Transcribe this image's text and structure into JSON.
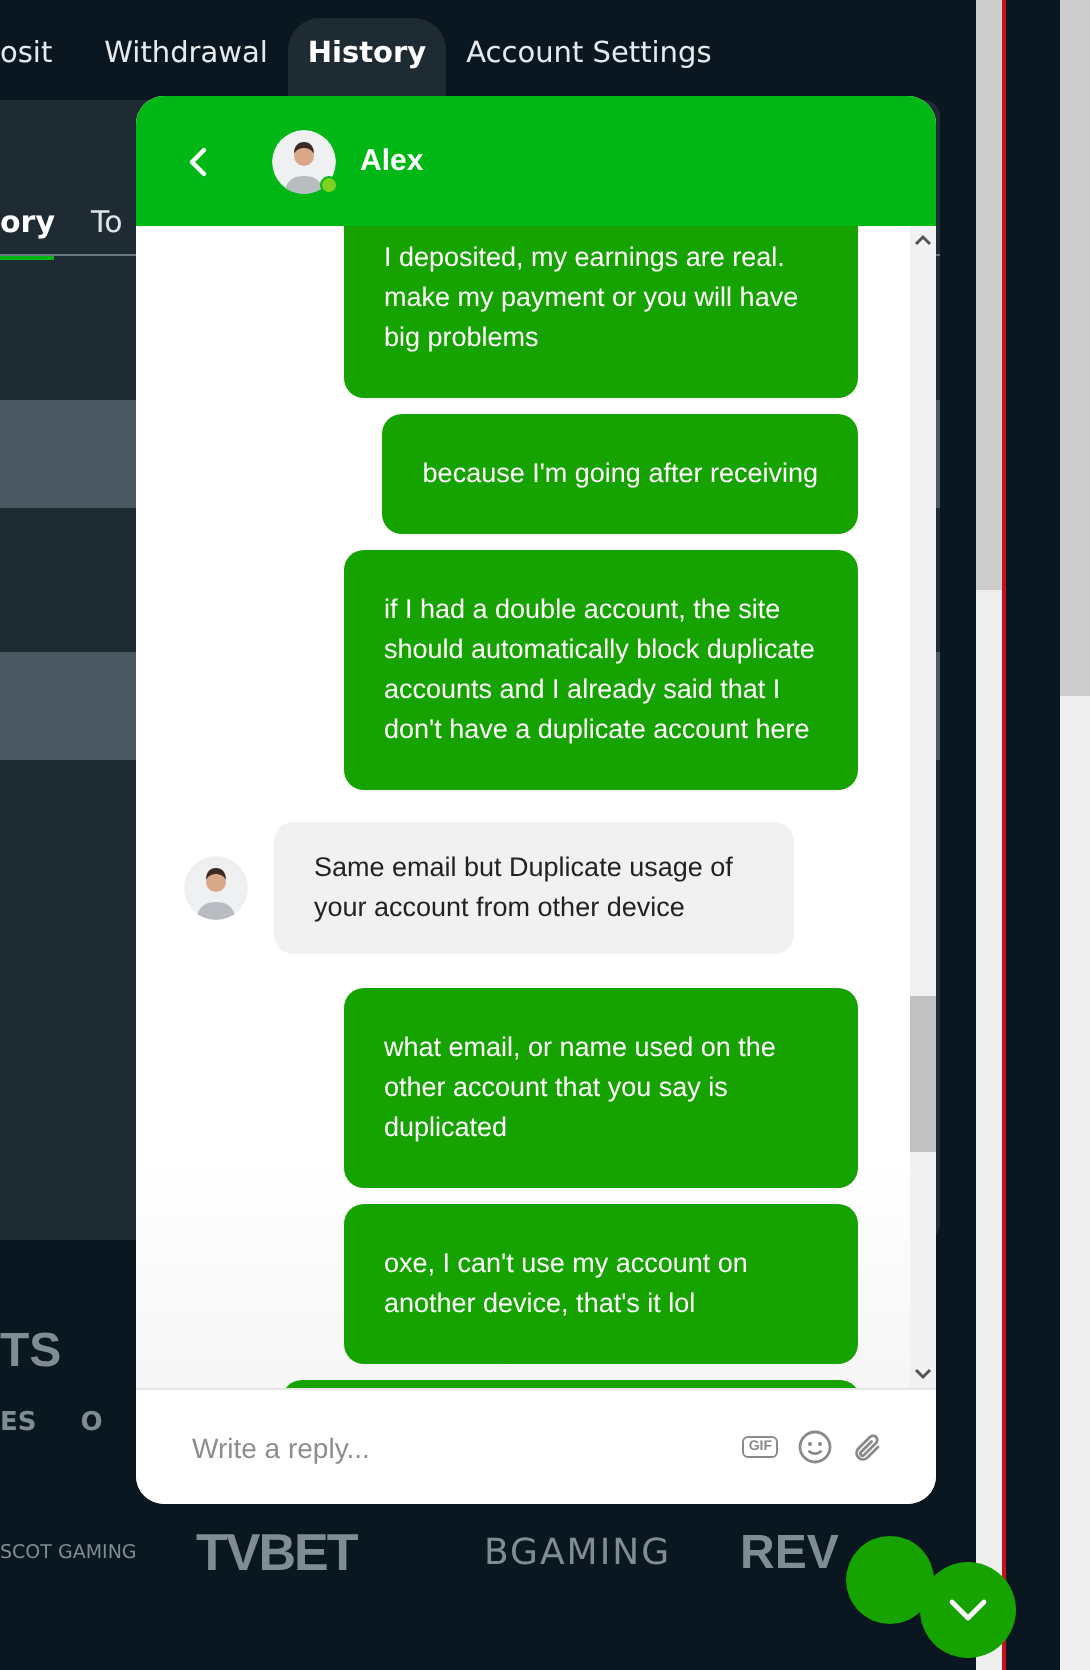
{
  "page_tabs": [
    {
      "label": "osit",
      "selected": false
    },
    {
      "label": "Withdrawal",
      "selected": false
    },
    {
      "label": "History",
      "selected": true
    },
    {
      "label": "Account Settings",
      "selected": false
    }
  ],
  "sub_tabs": [
    {
      "label": "ory",
      "selected": true
    },
    {
      "label": "To",
      "selected": false
    }
  ],
  "section_heading": "TS",
  "provider_logos_top": [
    "ES",
    "O"
  ],
  "provider_logos": [
    "SCOT GAMING",
    "TVBET",
    "BGAMING",
    "REV"
  ],
  "chat": {
    "agent_name": "Alex",
    "online": true,
    "messages": [
      {
        "kind": "sent",
        "text": "I deposited, my earnings are real. make my payment or you will have big problems"
      },
      {
        "kind": "sent",
        "text": "because I'm going after receiving"
      },
      {
        "kind": "sent",
        "text": "if I had a double account, the site should automatically block duplicate accounts and I already said that I don't have a duplicate account here"
      },
      {
        "kind": "received",
        "text": "Same email but Duplicate usage of your account from other device"
      },
      {
        "kind": "sent",
        "text": "what email, or name used on the other account that you say is duplicated"
      },
      {
        "kind": "sent",
        "text": "oxe, I can't use my account on another device, that's it lol"
      },
      {
        "kind": "sent"
      }
    ],
    "composer": {
      "placeholder": "Write a reply...",
      "gif_label": "GIF"
    }
  }
}
